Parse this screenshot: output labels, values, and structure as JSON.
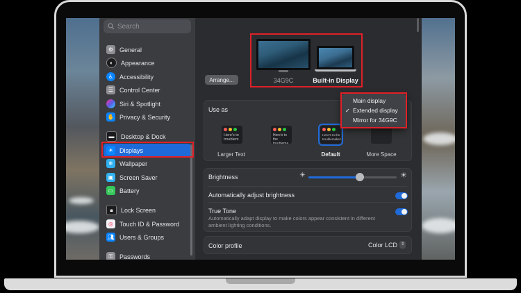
{
  "sidebar": {
    "search_placeholder": "Search",
    "items": [
      {
        "label": "General",
        "icon": "gear-icon",
        "color": "#8e8e93"
      },
      {
        "label": "Appearance",
        "icon": "appearance-icon",
        "color": "#1c1c1e"
      },
      {
        "label": "Accessibility",
        "icon": "accessibility-icon",
        "color": "#0a84ff"
      },
      {
        "label": "Control Center",
        "icon": "control-center-icon",
        "color": "#8e8e93"
      },
      {
        "label": "Siri & Spotlight",
        "icon": "siri-icon",
        "color": "#bf5af2"
      },
      {
        "label": "Privacy & Security",
        "icon": "hand-icon",
        "color": "#0a84ff"
      },
      {
        "label": "Desktop & Dock",
        "icon": "dock-icon",
        "color": "#1c1c1e"
      },
      {
        "label": "Displays",
        "icon": "sun-icon",
        "color": "#0a84ff"
      },
      {
        "label": "Wallpaper",
        "icon": "snowflake-icon",
        "color": "#30b0f0"
      },
      {
        "label": "Screen Saver",
        "icon": "screen-saver-icon",
        "color": "#30b0f0"
      },
      {
        "label": "Battery",
        "icon": "battery-icon",
        "color": "#34c759"
      },
      {
        "label": "Lock Screen",
        "icon": "lock-icon",
        "color": "#1c1c1e"
      },
      {
        "label": "Touch ID & Password",
        "icon": "fingerprint-icon",
        "color": "#f2f2f7"
      },
      {
        "label": "Users & Groups",
        "icon": "users-icon",
        "color": "#0a84ff"
      },
      {
        "label": "Passwords",
        "icon": "key-icon",
        "color": "#8e8e93"
      }
    ]
  },
  "displays": {
    "arrange_label": "Arrange...",
    "display_1_name": "34G9C",
    "display_2_name": "Built-in Display"
  },
  "use_as": {
    "label": "Use as",
    "menu": [
      "Main display",
      "Extended display",
      "Mirror for 34G9C"
    ],
    "checked": "Extended display",
    "resolutions": [
      {
        "caption": "Larger Text",
        "sample": "Here's to troublem"
      },
      {
        "caption": "",
        "sample": "Here's to the troublema ones who"
      },
      {
        "caption": "Default",
        "sample": "Here's to the troublemakers"
      },
      {
        "caption": "More Space",
        "sample": ""
      }
    ]
  },
  "brightness": {
    "label": "Brightness",
    "level": 0.58,
    "auto_label": "Automatically adjust brightness",
    "auto_on": true,
    "true_tone_label": "True Tone",
    "true_tone_desc": "Automatically adapt display to make colors appear consistent in different ambient lighting conditions.",
    "true_tone_on": true
  },
  "color_profile": {
    "label": "Color profile",
    "value": "Color LCD"
  },
  "colors": {
    "accent": "#1f6ad9",
    "highlight": "#e02027"
  }
}
